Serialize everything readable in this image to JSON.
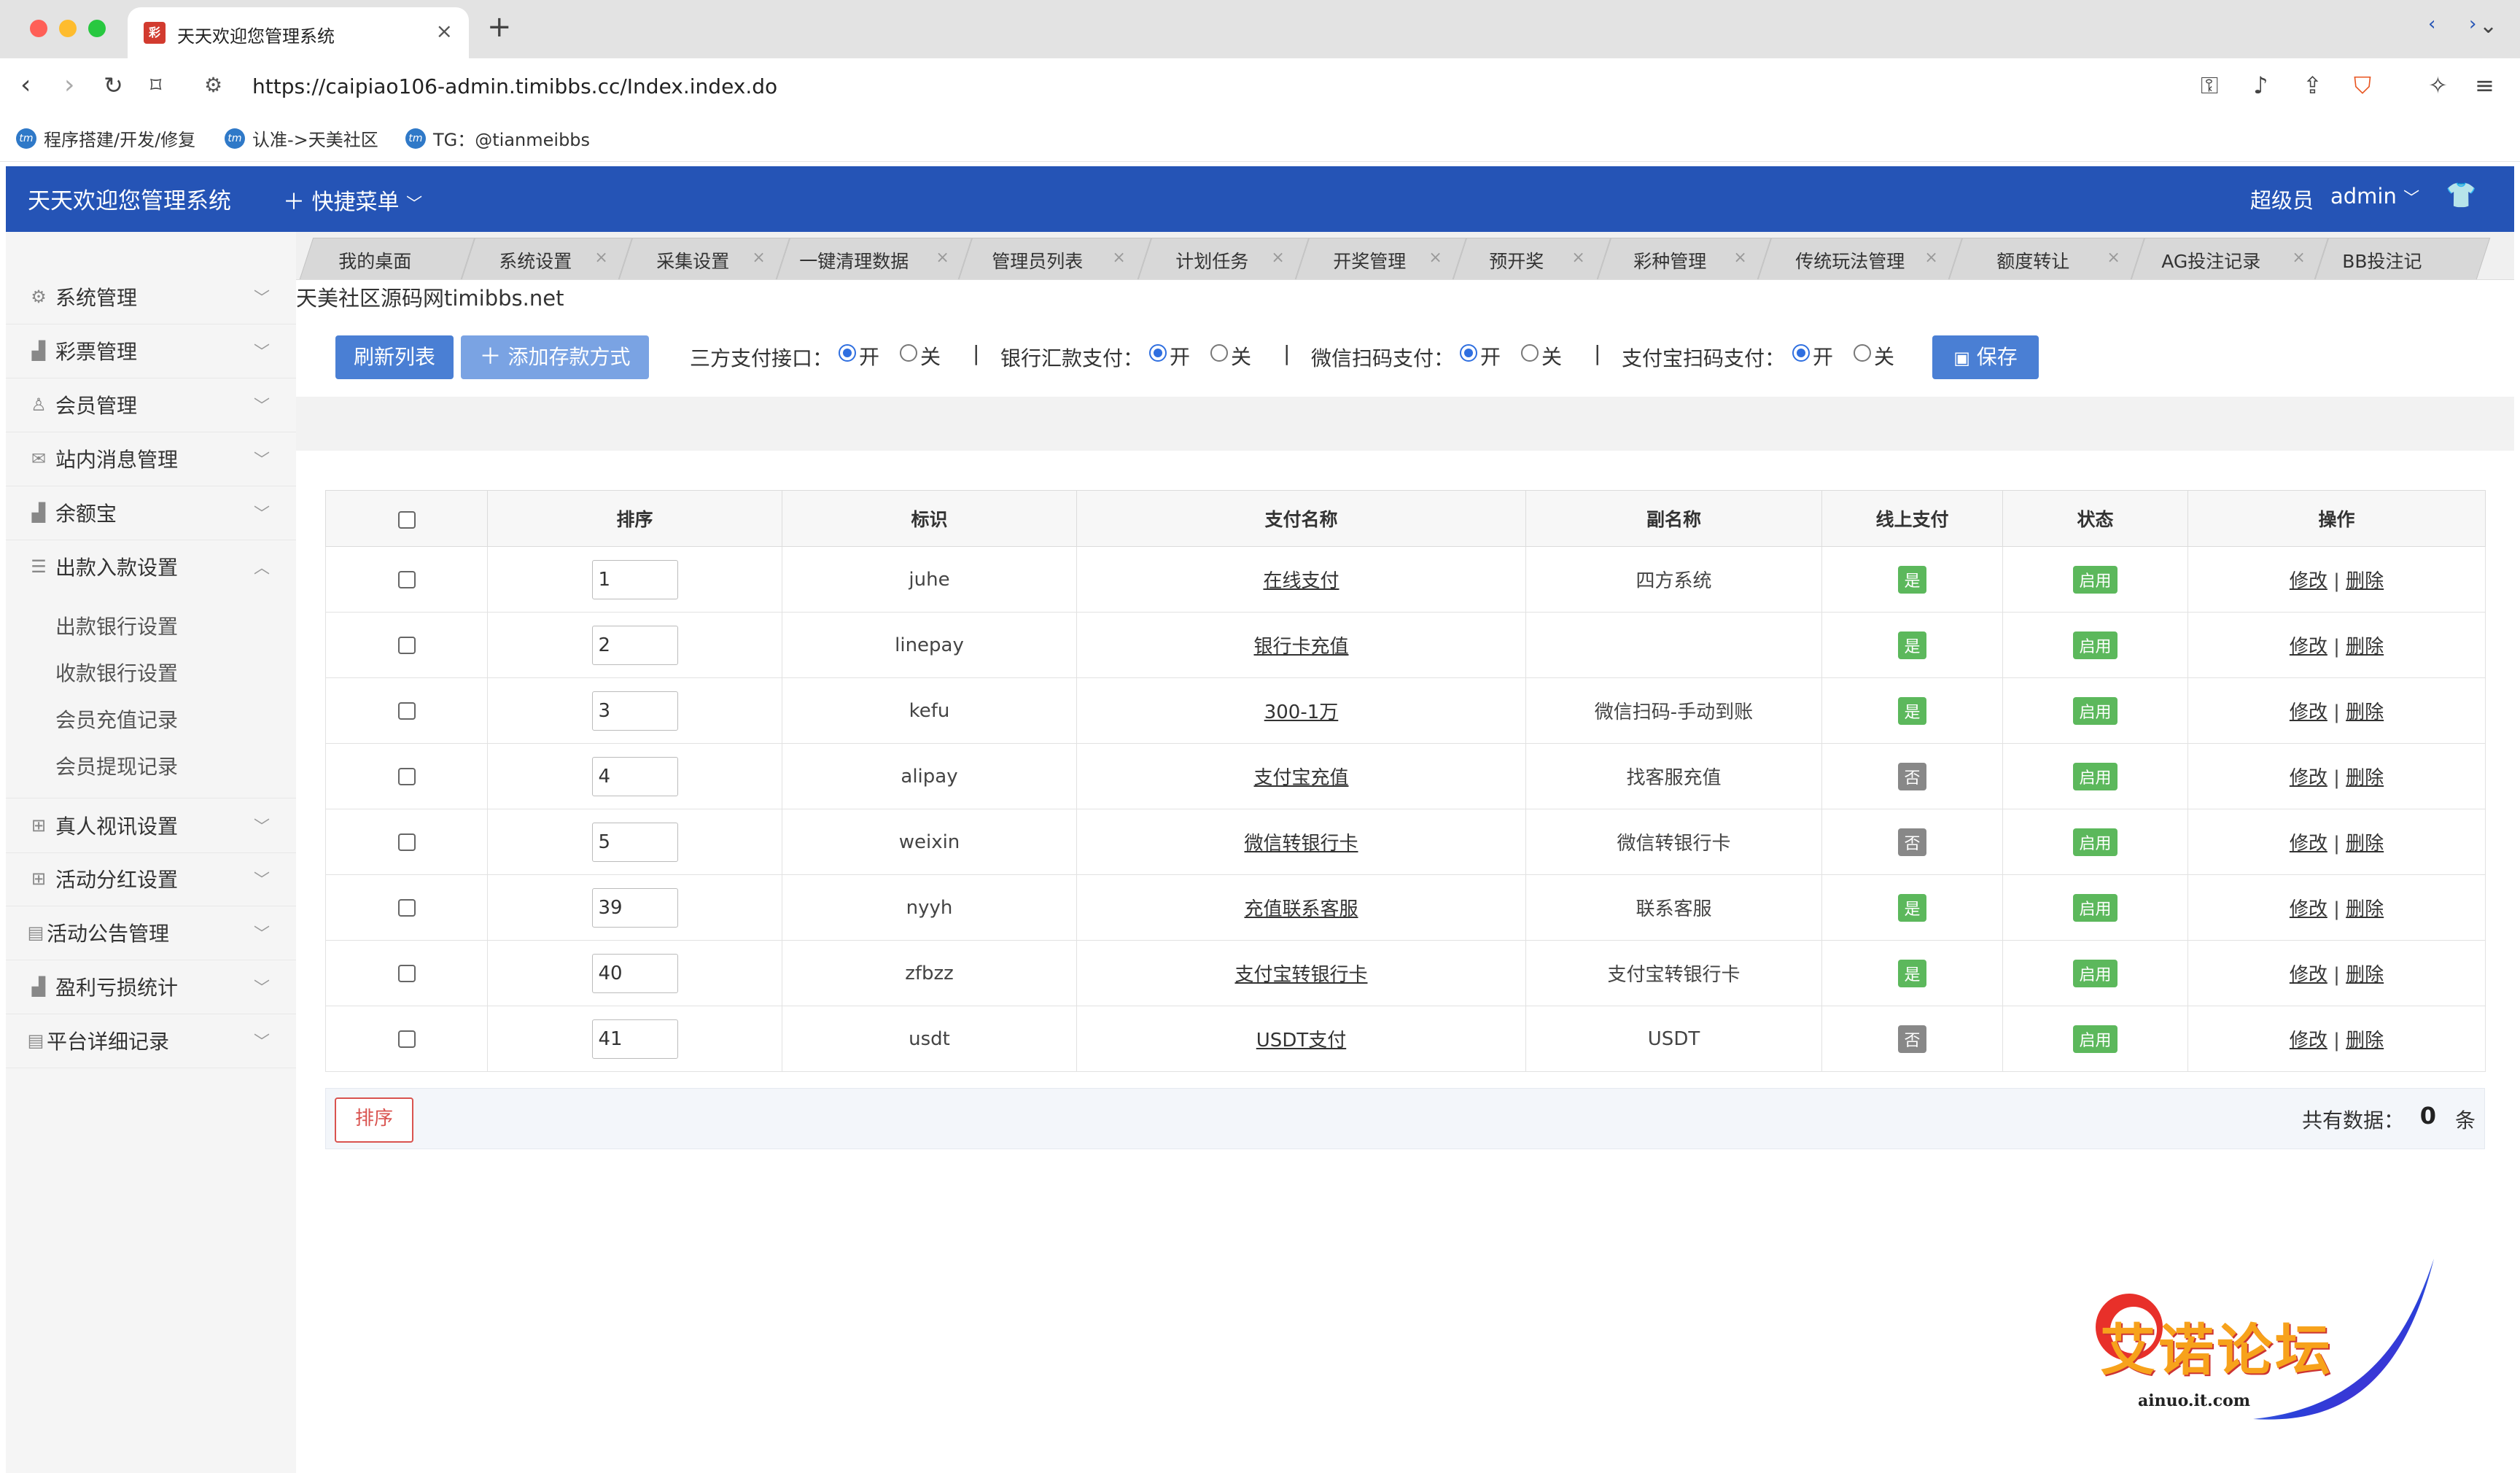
{
  "browser": {
    "tab_title": "天天欢迎您管理系统",
    "url": "https://caipiao106-admin.timibbs.cc/Index.index.do",
    "bookmarks": [
      "程序搭建/开发/修复",
      "认准->天美社区",
      "TG：@tianmeibbs"
    ]
  },
  "header": {
    "title": "天天欢迎您管理系统",
    "quick_menu": "快捷菜单",
    "user_role": "超级员",
    "user_name": "admin"
  },
  "sidebar": {
    "items": [
      {
        "label": "系统管理"
      },
      {
        "label": "彩票管理"
      },
      {
        "label": "会员管理"
      },
      {
        "label": "站内消息管理"
      },
      {
        "label": "余额宝"
      },
      {
        "label": "出款入款设置"
      },
      {
        "label": "真人视讯设置"
      },
      {
        "label": "活动分红设置"
      },
      {
        "label": "活动公告管理"
      },
      {
        "label": "盈利亏损统计"
      },
      {
        "label": "平台详细记录"
      }
    ],
    "subitems": [
      "出款银行设置",
      "收款银行设置",
      "会员充值记录",
      "会员提现记录"
    ]
  },
  "page_tabs": [
    "我的桌面",
    "系统设置",
    "采集设置",
    "一键清理数据",
    "管理员列表",
    "计划任务",
    "开奖管理",
    "预开奖",
    "彩种管理",
    "传统玩法管理",
    "额度转让",
    "AG投注记录",
    "BB投注记"
  ],
  "watermark_text": "天美社区源码网timibbs.net",
  "toolbar": {
    "refresh": "刷新列表",
    "add": "添加存款方式",
    "save": "保存",
    "toggles": [
      {
        "label": "三方支付接口：",
        "on": "开",
        "off": "关",
        "selected": "开"
      },
      {
        "label": "银行汇款支付：",
        "on": "开",
        "off": "关",
        "selected": "开"
      },
      {
        "label": "微信扫码支付：",
        "on": "开",
        "off": "关",
        "selected": "开"
      },
      {
        "label": "支付宝扫码支付：",
        "on": "开",
        "off": "关",
        "selected": "开"
      }
    ],
    "separator": "|"
  },
  "table": {
    "columns": [
      "排序",
      "标识",
      "支付名称",
      "副名称",
      "线上支付",
      "状态",
      "操作"
    ],
    "rows": [
      {
        "sort": "1",
        "id": "juhe",
        "name": "在线支付",
        "subname": "四方系统",
        "online": "是",
        "status": "启用"
      },
      {
        "sort": "2",
        "id": "linepay",
        "name": "银行卡充值",
        "subname": "",
        "online": "是",
        "status": "启用"
      },
      {
        "sort": "3",
        "id": "kefu",
        "name": "300-1万",
        "subname": "微信扫码-手动到账",
        "online": "是",
        "status": "启用"
      },
      {
        "sort": "4",
        "id": "alipay",
        "name": "支付宝充值",
        "subname": "找客服充值",
        "online": "否",
        "status": "启用"
      },
      {
        "sort": "5",
        "id": "weixin",
        "name": "微信转银行卡",
        "subname": "微信转银行卡",
        "online": "否",
        "status": "启用"
      },
      {
        "sort": "39",
        "id": "nyyh",
        "name": "充值联系客服",
        "subname": "联系客服",
        "online": "是",
        "status": "启用"
      },
      {
        "sort": "40",
        "id": "zfbzz",
        "name": "支付宝转银行卡",
        "subname": "支付宝转银行卡",
        "online": "是",
        "status": "启用"
      },
      {
        "sort": "41",
        "id": "usdt",
        "name": "USDT支付",
        "subname": "USDT",
        "online": "否",
        "status": "启用"
      }
    ],
    "edit_label": "修改",
    "delete_label": "删除",
    "op_sep": "|"
  },
  "footer": {
    "sort_button": "排序",
    "total_label": "共有数据：",
    "total_count": "0",
    "total_unit": "条"
  },
  "logo": {
    "text": "艾诺论坛",
    "url": "ainuo.it.com"
  },
  "colors": {
    "header_blue": "#2554b6",
    "badge_green": "#5cb85c",
    "badge_gray": "#888888",
    "danger_red": "#d9534f"
  }
}
